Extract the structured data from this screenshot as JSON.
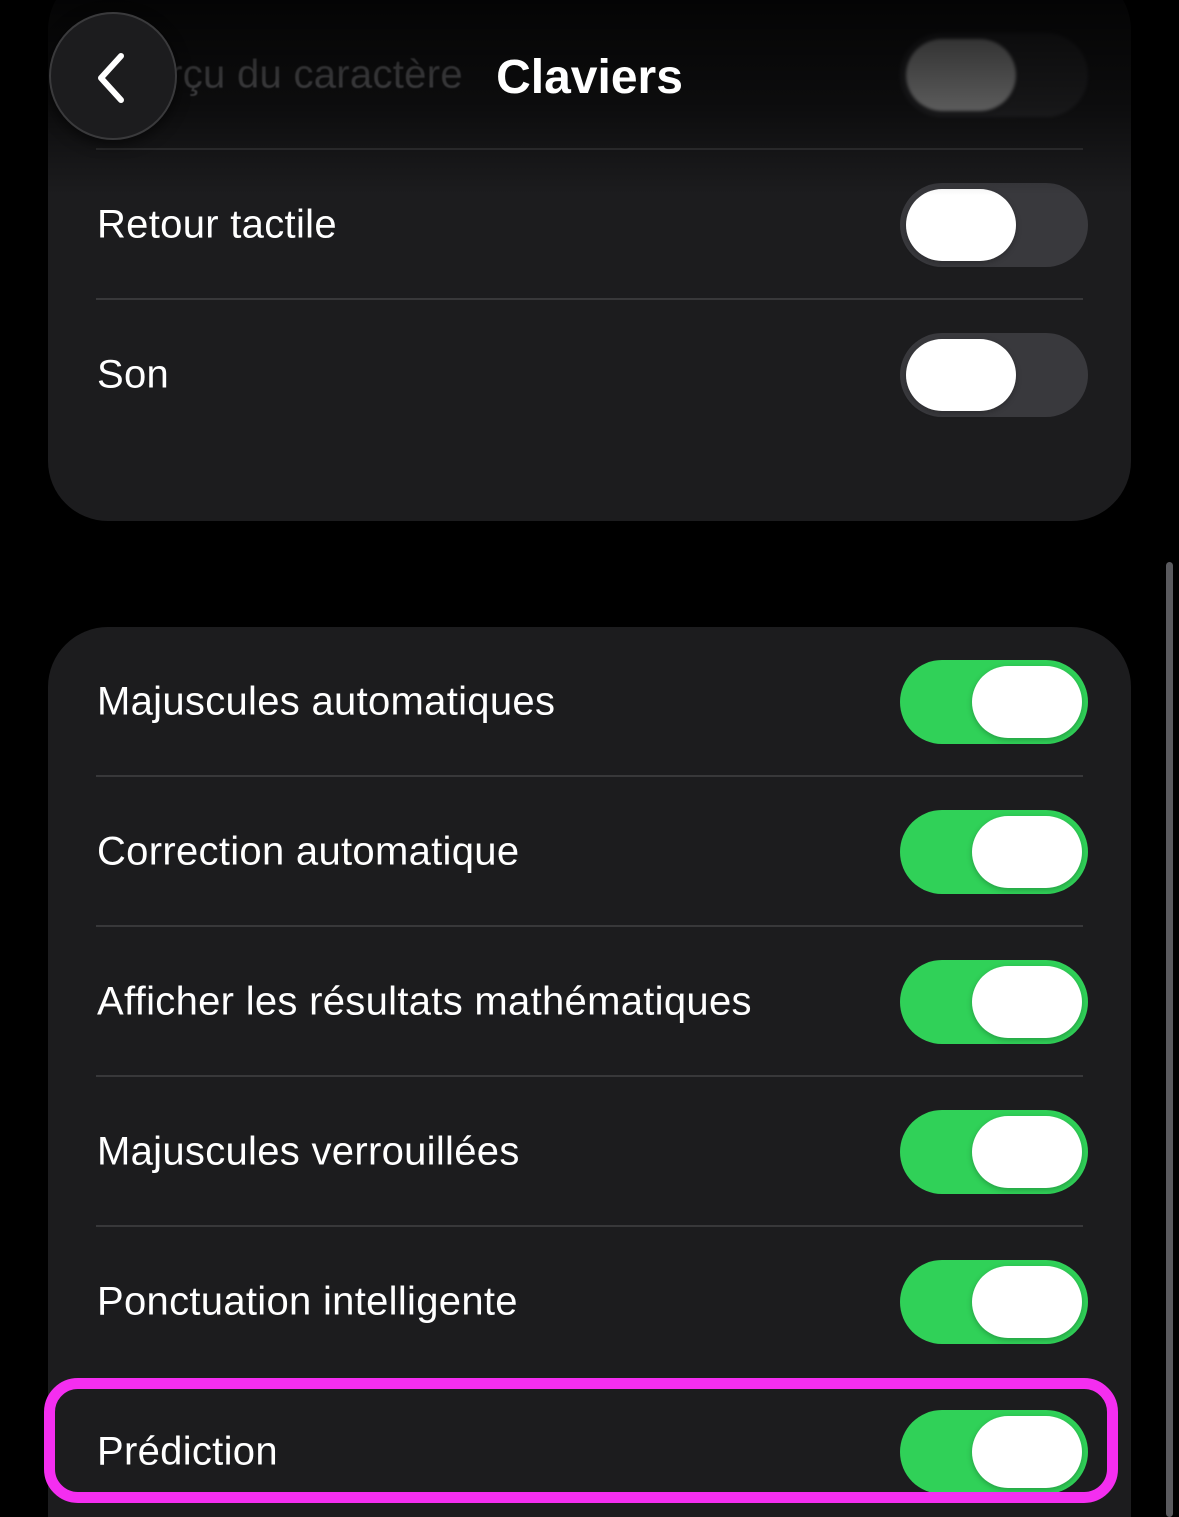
{
  "header": {
    "title": "Claviers",
    "back_icon": "chevron-left-icon"
  },
  "group_top": {
    "rows": [
      {
        "label": "Aperçu du caractère",
        "state": "off"
      },
      {
        "label": "Retour tactile",
        "state": "off"
      },
      {
        "label": "Son",
        "state": "off"
      }
    ]
  },
  "group_bottom": {
    "rows": [
      {
        "label": "Majuscules automatiques",
        "state": "on"
      },
      {
        "label": "Correction automatique",
        "state": "on"
      },
      {
        "label": "Afficher les résultats mathématiques",
        "state": "on"
      },
      {
        "label": "Majuscules verrouillées",
        "state": "on"
      },
      {
        "label": "Ponctuation intelligente",
        "state": "on"
      },
      {
        "label": "Prédiction",
        "state": "on"
      }
    ]
  },
  "colors": {
    "background": "#000000",
    "group_background": "#1c1c1e",
    "toggle_on": "#30d158",
    "toggle_off": "#39393d",
    "highlight": "#f42ef0"
  }
}
